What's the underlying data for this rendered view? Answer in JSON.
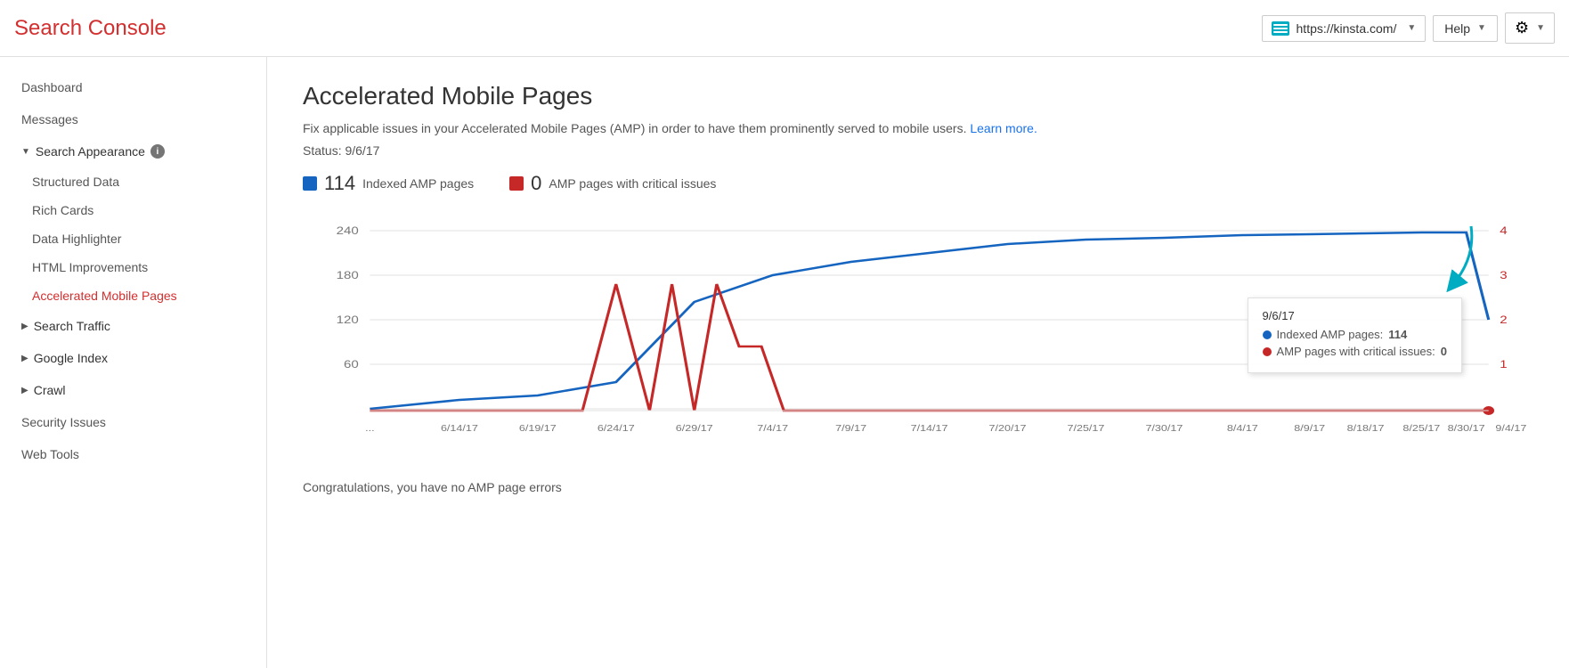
{
  "header": {
    "title": "Search Console",
    "site_url": "https://kinsta.com/",
    "help_label": "Help",
    "gear_icon_label": "settings"
  },
  "sidebar": {
    "items": [
      {
        "id": "dashboard",
        "label": "Dashboard",
        "type": "item"
      },
      {
        "id": "messages",
        "label": "Messages",
        "type": "item"
      },
      {
        "id": "search-appearance",
        "label": "Search Appearance",
        "type": "section-open",
        "has_info": true
      },
      {
        "id": "structured-data",
        "label": "Structured Data",
        "type": "sub"
      },
      {
        "id": "rich-cards",
        "label": "Rich Cards",
        "type": "sub"
      },
      {
        "id": "data-highlighter",
        "label": "Data Highlighter",
        "type": "sub"
      },
      {
        "id": "html-improvements",
        "label": "HTML Improvements",
        "type": "sub"
      },
      {
        "id": "amp",
        "label": "Accelerated Mobile Pages",
        "type": "sub",
        "active": true
      },
      {
        "id": "search-traffic",
        "label": "Search Traffic",
        "type": "section"
      },
      {
        "id": "google-index",
        "label": "Google Index",
        "type": "section"
      },
      {
        "id": "crawl",
        "label": "Crawl",
        "type": "section"
      },
      {
        "id": "security-issues",
        "label": "Security Issues",
        "type": "item"
      },
      {
        "id": "web-tools",
        "label": "Web Tools",
        "type": "item"
      }
    ]
  },
  "main": {
    "page_title": "Accelerated Mobile Pages",
    "description": "Fix applicable issues in your Accelerated Mobile Pages (AMP) in order to have them prominently served to mobile users.",
    "learn_more_label": "Learn more.",
    "status_label": "Status: 9/6/17",
    "stats": {
      "indexed": {
        "count": "114",
        "label": "Indexed AMP pages"
      },
      "critical": {
        "count": "0",
        "label": "AMP pages with critical issues"
      }
    },
    "chart": {
      "y_labels_left": [
        "240",
        "180",
        "120",
        "60"
      ],
      "y_labels_right": [
        "4",
        "3",
        "2",
        "1"
      ],
      "x_labels": [
        "...",
        "6/14/17",
        "6/19/17",
        "6/24/17",
        "6/29/17",
        "7/4/17",
        "7/9/17",
        "7/14/17",
        "7/20/17",
        "7/25/17",
        "7/30/17",
        "8/4/17",
        "8/9/17",
        "8/18/17",
        "8/25/17",
        "8/30/17",
        "9/4/17"
      ],
      "tooltip": {
        "date": "9/6/17",
        "indexed_label": "Indexed AMP pages:",
        "indexed_value": "114",
        "critical_label": "AMP pages with critical issues:",
        "critical_value": "0"
      }
    },
    "congratulations": "Congratulations, you have no AMP page errors"
  }
}
